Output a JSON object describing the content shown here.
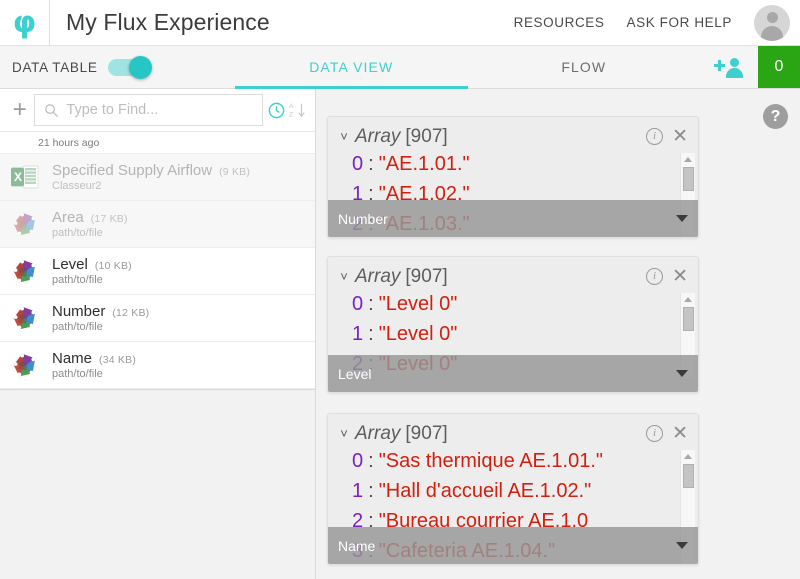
{
  "topbar": {
    "logo_glyph": "φ",
    "logo_icon": "flux-logo-icon",
    "title": "My Flux Experience",
    "links": [
      {
        "label": "RESOURCES"
      },
      {
        "label": "ASK FOR HELP"
      }
    ],
    "avatar_icon": "user-avatar-icon"
  },
  "tabbar": {
    "datatable_label": "DATA TABLE",
    "datatable_toggle_on": true,
    "tabs": [
      {
        "label": "DATA VIEW",
        "active": true
      },
      {
        "label": "FLOW",
        "active": false
      }
    ],
    "adduser_icon": "add-user-icon",
    "count_badge": "0",
    "count_badge_color": "#2aa514",
    "accent_color": "#3dd0cf"
  },
  "sidebar": {
    "add_label": "+",
    "search": {
      "placeholder": "Type to Find...",
      "value": "",
      "search_icon": "search-icon"
    },
    "history_icon": "history-clock-icon",
    "sort_icon": "sort-alpha-icon",
    "group_label": "21 hours ago",
    "files": [
      {
        "name": "Specified Supply Airflow",
        "size": "(9 KB)",
        "path": "Classeur2",
        "icon": "excel-file-icon",
        "dim": true
      },
      {
        "name": "Area",
        "size": "(17 KB)",
        "path": "path/to/file",
        "icon": "data-rhombus-icon",
        "dim": true
      },
      {
        "name": "Level",
        "size": "(10 KB)",
        "path": "path/to/file",
        "icon": "data-rhombus-icon",
        "dim": false
      },
      {
        "name": "Number",
        "size": "(12 KB)",
        "path": "path/to/file",
        "icon": "data-rhombus-icon",
        "dim": false
      },
      {
        "name": "Name",
        "size": "(34 KB)",
        "path": "path/to/file",
        "icon": "data-rhombus-icon",
        "dim": false
      }
    ]
  },
  "main": {
    "help_label": "?",
    "cards": [
      {
        "type": "Array",
        "count": "[907]",
        "footer": "Number",
        "rows": [
          {
            "idx": "0",
            "colon": ":",
            "value": "\"AE.1.01.\""
          },
          {
            "idx": "1",
            "colon": ":",
            "value": "\"AE.1.02.\""
          },
          {
            "idx": "2",
            "colon": ":",
            "value": "\"AE.1.03.\""
          }
        ]
      },
      {
        "type": "Array",
        "count": "[907]",
        "footer": "Level",
        "rows": [
          {
            "idx": "0",
            "colon": ":",
            "value": "\"Level 0\""
          },
          {
            "idx": "1",
            "colon": ":",
            "value": "\"Level 0\""
          },
          {
            "idx": "2",
            "colon": ":",
            "value": "\"Level 0\""
          }
        ]
      },
      {
        "type": "Array",
        "count": "[907]",
        "footer": "Name",
        "rows": [
          {
            "idx": "0",
            "colon": ":",
            "value": "\"Sas thermique AE.1.01.\""
          },
          {
            "idx": "1",
            "colon": ":",
            "value": "\"Hall d'accueil AE.1.02.\""
          },
          {
            "idx": "2",
            "colon": ":",
            "value": "\"Bureau courrier AE.1.0"
          },
          {
            "idx": "3",
            "colon": ":",
            "value": "\"Cafeteria AE.1.04.\""
          }
        ]
      }
    ],
    "info_icon": "info-icon",
    "close_icon": "close-icon",
    "collapse_icon": "chevron-down-icon",
    "scroll_icon": "scrollbar"
  }
}
